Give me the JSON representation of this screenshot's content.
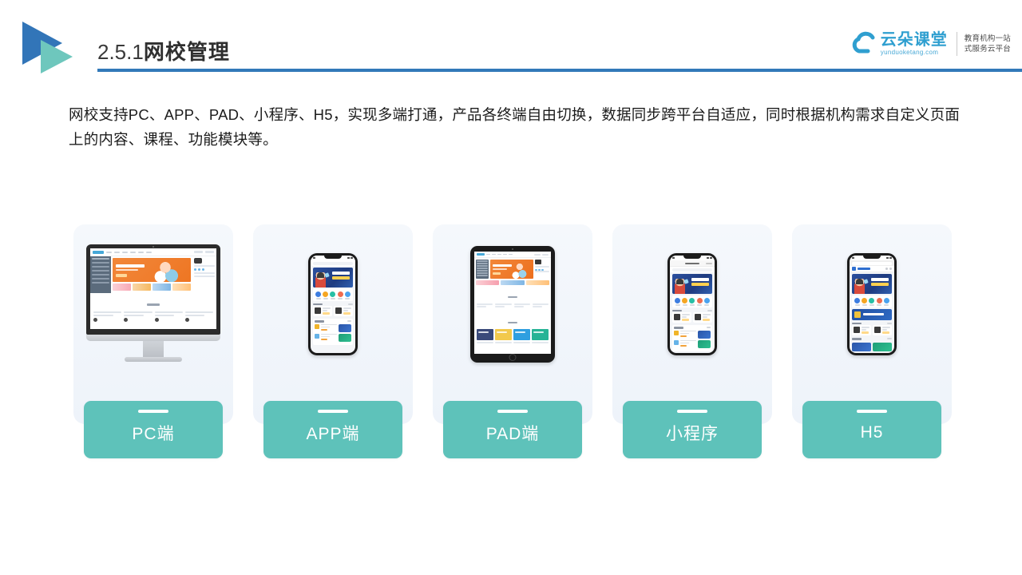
{
  "header": {
    "slide_number": "2.5.1",
    "title": "网校管理",
    "logo_icon": "double-triangle-play-icon",
    "brand": {
      "cloud_icon": "cloud-logo-icon",
      "name": "云朵课堂",
      "domain": "yunduoketang.com",
      "tagline_line1": "教育机构一站",
      "tagline_line2": "式服务云平台",
      "accent_color": "#2f9fd0"
    },
    "rule_color": "#3279b9"
  },
  "body_text": {
    "paragraph": "网校支持PC、APP、PAD、小程序、H5，实现多端打通，产品各终端自由切换，数据同步跨平台自适应，同时根据机构需求自定义页面上的内容、课程、功能模块等。"
  },
  "cards": [
    {
      "id": "pc",
      "label": "PC端",
      "device": "desktop",
      "device_icon": "desktop-monitor-icon"
    },
    {
      "id": "app",
      "label": "APP端",
      "device": "phone",
      "device_icon": "smartphone-icon"
    },
    {
      "id": "pad",
      "label": "PAD端",
      "device": "tablet",
      "device_icon": "tablet-icon"
    },
    {
      "id": "miniapp",
      "label": "小程序",
      "device": "phone",
      "device_icon": "smartphone-icon"
    },
    {
      "id": "h5",
      "label": "H5",
      "device": "phone",
      "device_icon": "smartphone-icon"
    }
  ],
  "theme": {
    "button_color": "#5ec2ba",
    "card_background": "#f2f5fa",
    "title_color": "#2f2f2f",
    "text_color": "#1c1c1c"
  },
  "mockup_content": {
    "app_banner_headline": "职场人的",
    "app_banner_subhead": "第一堂问答课",
    "desktop_banner_color": "#ee7623"
  }
}
